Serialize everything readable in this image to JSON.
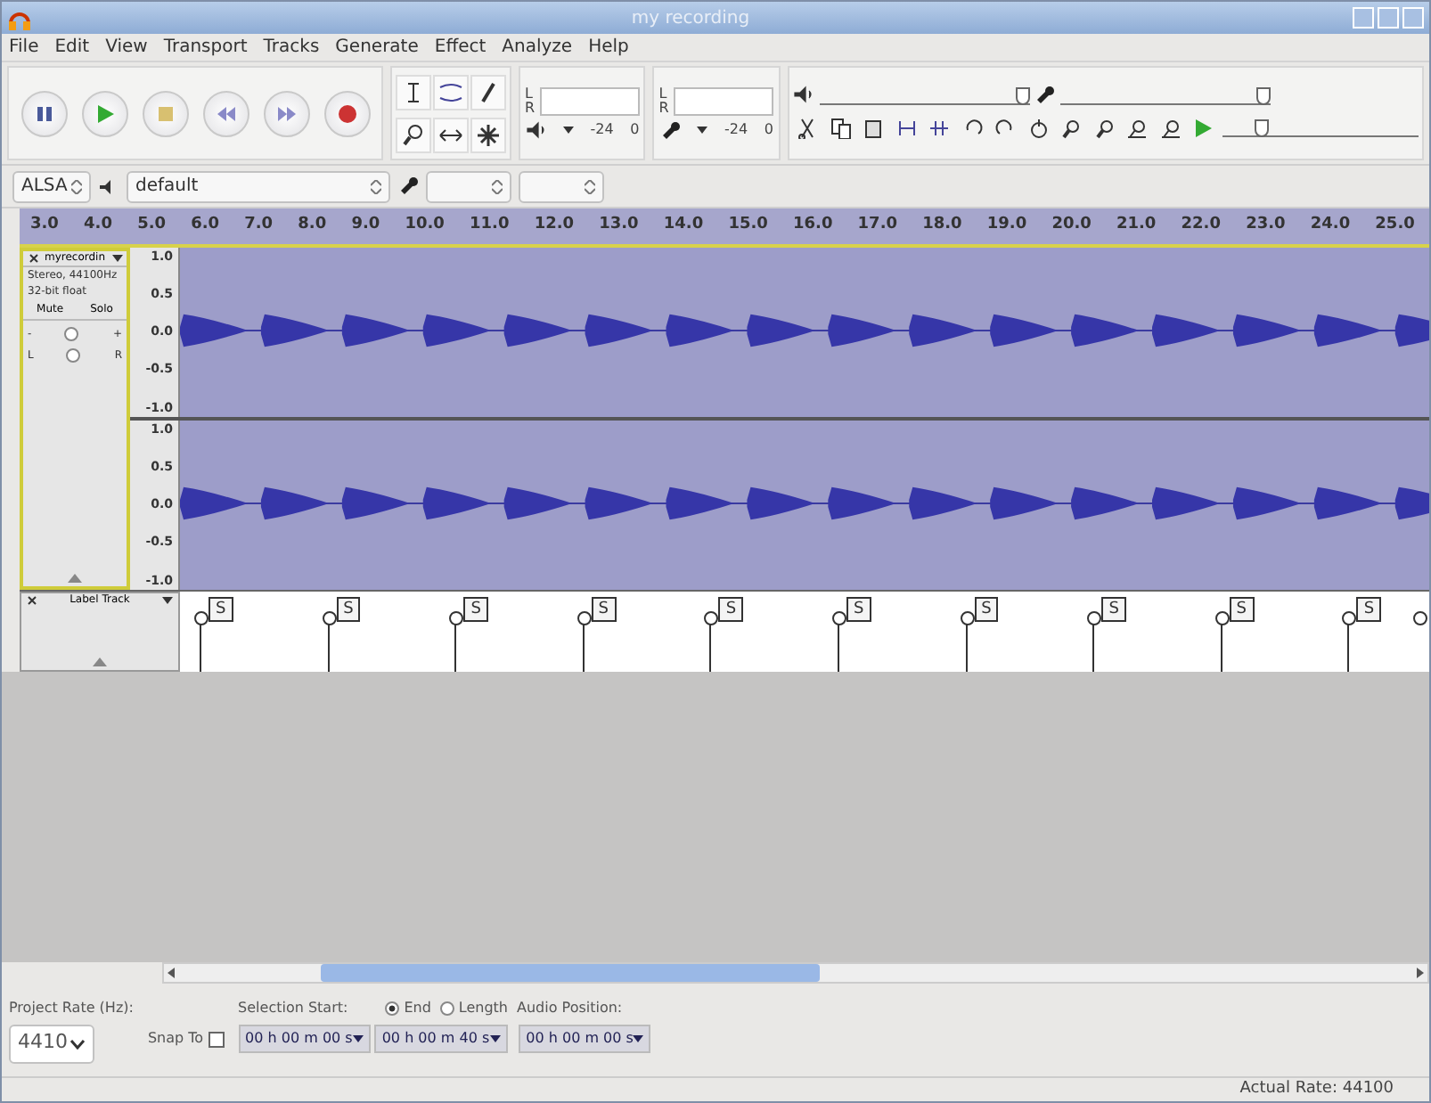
{
  "window": {
    "title": "my recording"
  },
  "menu": [
    "File",
    "Edit",
    "View",
    "Transport",
    "Tracks",
    "Generate",
    "Effect",
    "Analyze",
    "Help"
  ],
  "meters": [
    {
      "kind": "playback",
      "channels": [
        "L",
        "R"
      ],
      "scale": [
        "-24",
        "0"
      ]
    },
    {
      "kind": "record",
      "channels": [
        "L",
        "R"
      ],
      "scale": [
        "-24",
        "0"
      ]
    }
  ],
  "mixer": [
    {
      "kind": "playback",
      "level": 0.97
    },
    {
      "kind": "record",
      "level": 0.97
    }
  ],
  "play_at_speed": {
    "level": 0.2
  },
  "device_toolbar": {
    "host": "ALSA",
    "playback_device": "default"
  },
  "ruler": [
    "3.0",
    "4.0",
    "5.0",
    "6.0",
    "7.0",
    "8.0",
    "9.0",
    "10.0",
    "11.0",
    "12.0",
    "13.0",
    "14.0",
    "15.0",
    "16.0",
    "17.0",
    "18.0",
    "19.0",
    "20.0",
    "21.0",
    "22.0",
    "23.0",
    "24.0",
    "25.0"
  ],
  "audio_track": {
    "name": "myrecordin",
    "selected": true,
    "info": [
      "Stereo, 44100Hz",
      "32-bit float"
    ],
    "mute": "Mute",
    "solo": "Solo",
    "gain_minus": "-",
    "gain_plus": "+",
    "pan_left": "L",
    "pan_right": "R",
    "channels": [
      {
        "scale": [
          "1.0",
          "0.5",
          "0.0",
          "-0.5",
          "-1.0"
        ]
      },
      {
        "scale": [
          "1.0",
          "0.5",
          "0.0",
          "-0.5",
          "-1.0"
        ]
      }
    ]
  },
  "label_track": {
    "name": "Label Track",
    "labels": [
      "S",
      "S",
      "S",
      "S",
      "S",
      "S",
      "S",
      "S",
      "S",
      "S"
    ]
  },
  "selection_bar": {
    "rate_label": "Project Rate (Hz):",
    "rate": "4410",
    "snap_label": "Snap To",
    "snap": false,
    "start_label": "Selection Start:",
    "modes": [
      {
        "label": "End",
        "selected": true
      },
      {
        "label": "Length",
        "selected": false
      }
    ],
    "position_label": "Audio Position:",
    "start": "00 h 00 m 00 s",
    "end": "00 h 00 m 40 s",
    "position": "00 h 00 m 00 s"
  },
  "status_bar": {
    "rate": "Actual Rate: 44100"
  }
}
